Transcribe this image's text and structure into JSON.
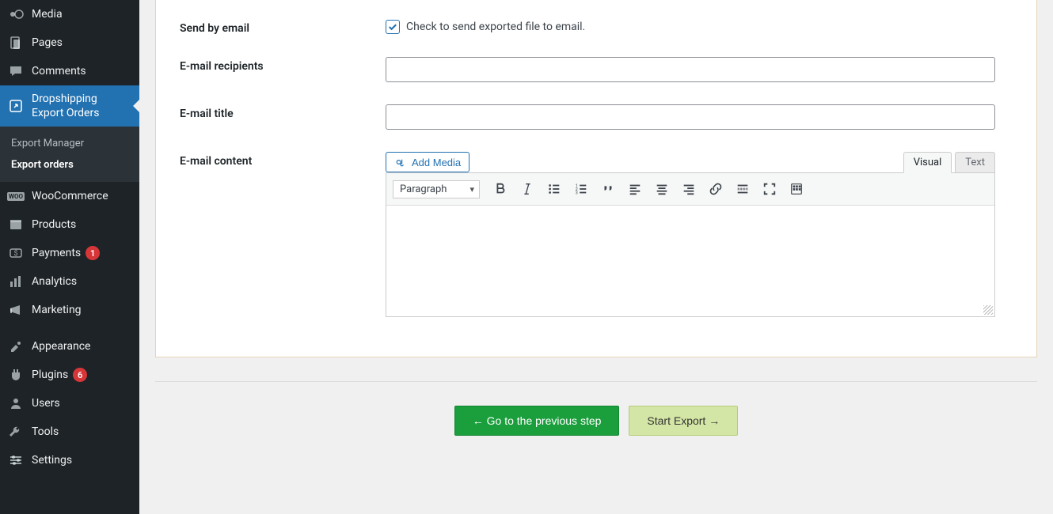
{
  "sidebar": {
    "media": "Media",
    "pages": "Pages",
    "comments": "Comments",
    "dropshipping_l1": "Dropshipping",
    "dropshipping_l2": "Export Orders",
    "sub_export_manager": "Export Manager",
    "sub_export_orders": "Export orders",
    "woocommerce": "WooCommerce",
    "woo_tag": "WOO",
    "products": "Products",
    "payments": "Payments",
    "payments_badge": "1",
    "analytics": "Analytics",
    "marketing": "Marketing",
    "appearance": "Appearance",
    "plugins": "Plugins",
    "plugins_badge": "6",
    "users": "Users",
    "tools": "Tools",
    "settings": "Settings"
  },
  "form": {
    "send_by_email_label": "Send by email",
    "send_by_email_desc": "Check to send exported file to email.",
    "email_recipients_label": "E-mail recipients",
    "email_title_label": "E-mail title",
    "email_content_label": "E-mail content"
  },
  "editor": {
    "add_media": "Add Media",
    "tab_visual": "Visual",
    "tab_text": "Text",
    "format_select": "Paragraph"
  },
  "buttons": {
    "prev": "← Go to the previous step",
    "start": "Start Export →"
  }
}
